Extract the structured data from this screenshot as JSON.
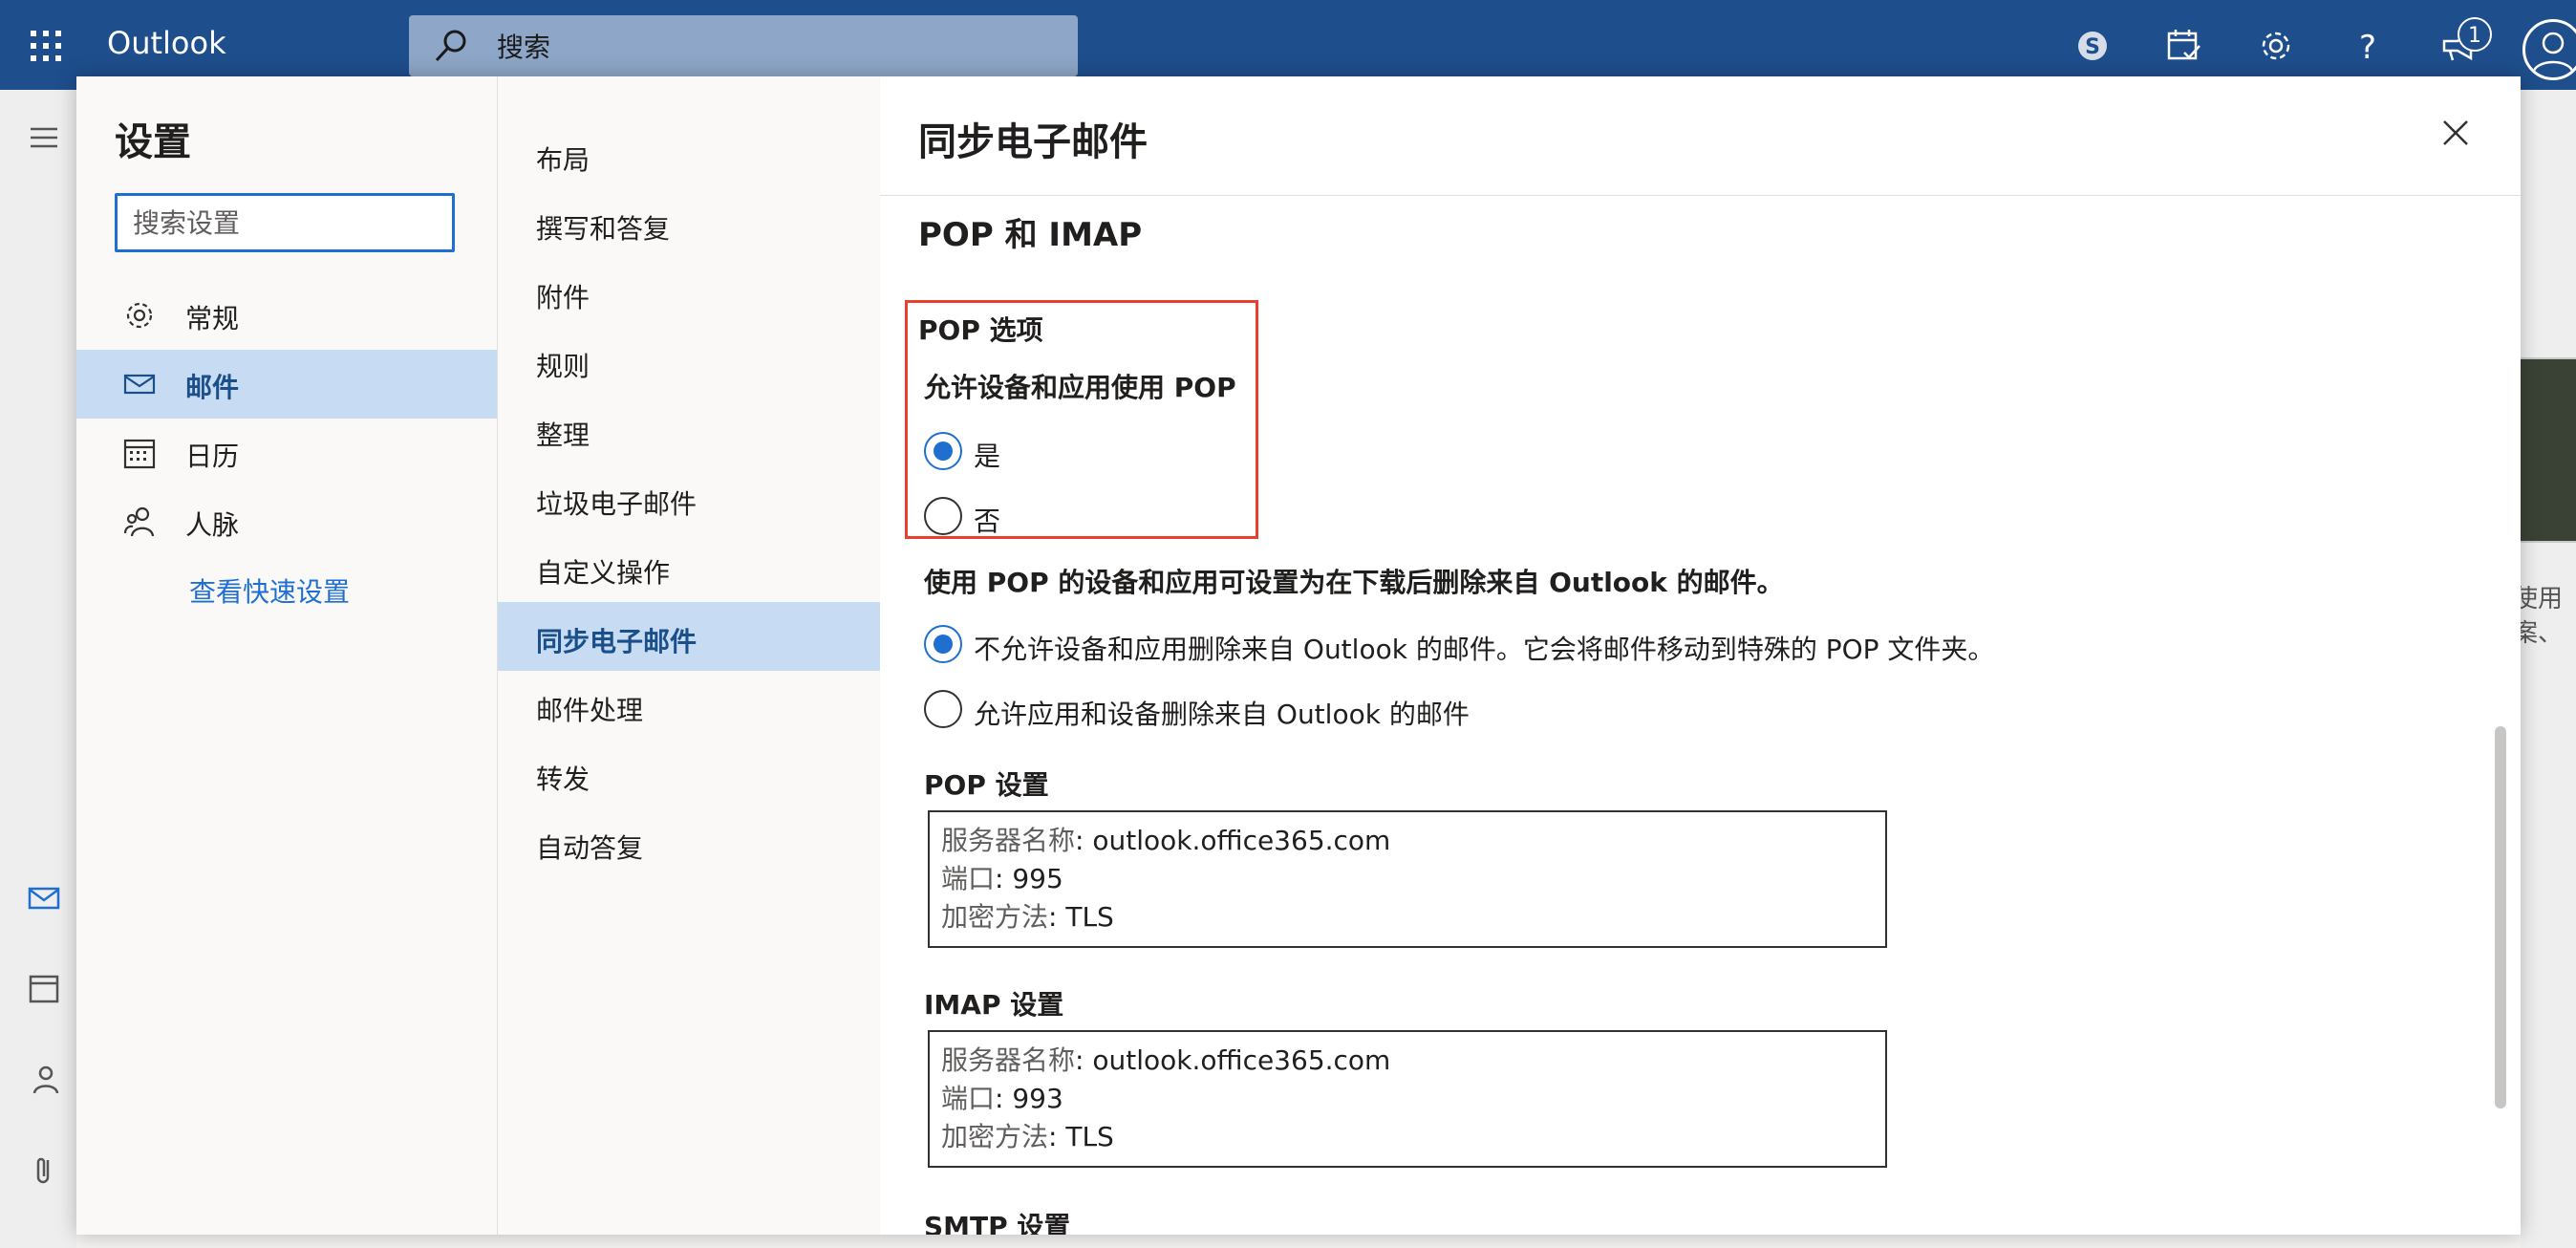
{
  "topbar": {
    "app_title": "Outlook",
    "search_placeholder": "搜索",
    "notification_count": "1",
    "icons": [
      "waffle-icon",
      "search-icon",
      "skype-icon",
      "calendar-check-icon",
      "gear-icon",
      "help-icon",
      "megaphone-icon",
      "avatar"
    ],
    "colors": {
      "bar": "#1e4e8c",
      "accent": "#1e6fd0"
    }
  },
  "background": {
    "right_text": [
      "使用",
      "案、"
    ]
  },
  "settings": {
    "title": "设置",
    "search_placeholder": "搜索设置",
    "categories": [
      {
        "label": "常规",
        "icon": "gear-icon",
        "selected": false
      },
      {
        "label": "邮件",
        "icon": "mail-icon",
        "selected": true
      },
      {
        "label": "日历",
        "icon": "calendar-icon",
        "selected": false
      },
      {
        "label": "人脉",
        "icon": "people-icon",
        "selected": false
      }
    ],
    "quick_settings_link": "查看快速设置",
    "mail_subitems": [
      {
        "label": "布局",
        "selected": false
      },
      {
        "label": "撰写和答复",
        "selected": false
      },
      {
        "label": "附件",
        "selected": false
      },
      {
        "label": "规则",
        "selected": false
      },
      {
        "label": "整理",
        "selected": false
      },
      {
        "label": "垃圾电子邮件",
        "selected": false
      },
      {
        "label": "自定义操作",
        "selected": false
      },
      {
        "label": "同步电子邮件",
        "selected": true
      },
      {
        "label": "邮件处理",
        "selected": false
      },
      {
        "label": "转发",
        "selected": false
      },
      {
        "label": "自动答复",
        "selected": false
      }
    ]
  },
  "content": {
    "title": "同步电子邮件",
    "section_title": "POP 和 IMAP",
    "pop_options": {
      "heading": "POP 选项",
      "question": "允许设备和应用使用 POP",
      "yes_label": "是",
      "no_label": "否",
      "selected": "yes"
    },
    "delete_question": "使用 POP 的设备和应用可设置为在下载后删除来自 Outlook 的邮件。",
    "delete_option_1": "不允许设备和应用删除来自 Outlook 的邮件。它会将邮件移动到特殊的 POP 文件夹。",
    "delete_option_2": "允许应用和设备删除来自 Outlook 的邮件",
    "delete_selected": "option_1",
    "pop_settings": {
      "heading": "POP 设置",
      "server_key": "服务器名称",
      "server_value": ": outlook.office365.com",
      "port_key": "端口",
      "port_value": ": 995",
      "encryption_key": "加密方法",
      "encryption_value": ": TLS"
    },
    "imap_settings": {
      "heading": "IMAP 设置",
      "server_key": "服务器名称",
      "server_value": ": outlook.office365.com",
      "port_key": "端口",
      "port_value": ": 993",
      "encryption_key": "加密方法",
      "encryption_value": ": TLS"
    },
    "smtp_heading": "SMTP 设置"
  }
}
